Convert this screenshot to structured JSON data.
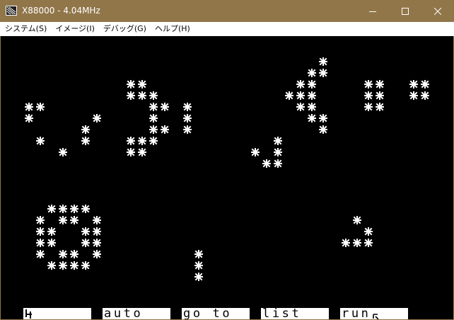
{
  "window": {
    "title": "X88000 - 4.04MHz",
    "app_icon": "x88000-app-icon",
    "controls": [
      "minimize-icon",
      "maximize-icon",
      "close-icon"
    ]
  },
  "menu": {
    "items": [
      "システム(S)",
      "イメージ(I)",
      "デバッグ(G)",
      "ヘルプ(H)"
    ]
  },
  "screen": {
    "background": "#000000",
    "foreground": "#ffffff",
    "glyph": "✱"
  },
  "function_keys": {
    "f1": "",
    "f2": "auto",
    "f3": "go to",
    "f4": "list",
    "f5": "run"
  },
  "colors": {
    "titlebar": "#91764a"
  }
}
